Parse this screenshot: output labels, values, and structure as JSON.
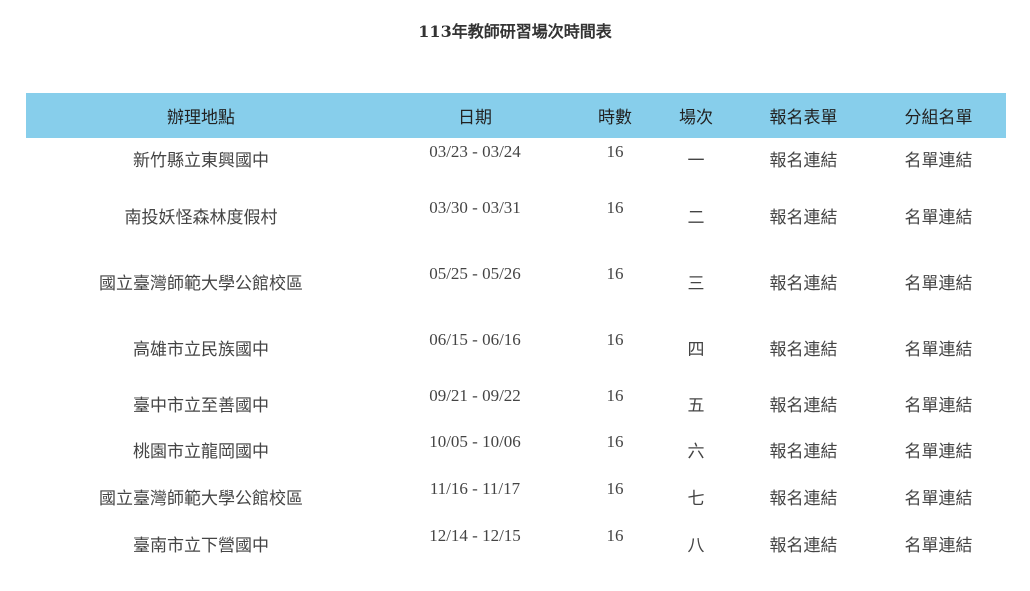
{
  "title": "113年教師研習場次時間表",
  "headers": {
    "location": "辦理地點",
    "date": "日期",
    "hours": "時數",
    "session": "場次",
    "form": "報名表單",
    "group": "分組名單"
  },
  "rows": [
    {
      "location": "新竹縣立東興國中",
      "date": "03/23 - 03/24",
      "hours": "16",
      "session": "一",
      "form": "報名連結",
      "group": "名單連結"
    },
    {
      "location": "南投妖怪森林度假村",
      "date": "03/30 - 03/31",
      "hours": "16",
      "session": "二",
      "form": "報名連結",
      "group": "名單連結"
    },
    {
      "location": "國立臺灣師範大學公館校區",
      "date": "05/25 - 05/26",
      "hours": "16",
      "session": "三",
      "form": "報名連結",
      "group": "名單連結"
    },
    {
      "location": "高雄市立民族國中",
      "date": "06/15 - 06/16",
      "hours": "16",
      "session": "四",
      "form": "報名連結",
      "group": "名單連結"
    },
    {
      "location": "臺中市立至善國中",
      "date": "09/21 - 09/22",
      "hours": "16",
      "session": "五",
      "form": "報名連結",
      "group": "名單連結"
    },
    {
      "location": "桃園市立龍岡國中",
      "date": "10/05 - 10/06",
      "hours": "16",
      "session": "六",
      "form": "報名連結",
      "group": "名單連結"
    },
    {
      "location": "國立臺灣師範大學公館校區",
      "date": "11/16 - 11/17",
      "hours": "16",
      "session": "七",
      "form": "報名連結",
      "group": "名單連結"
    },
    {
      "location": "臺南市立下營國中",
      "date": "12/14 - 12/15",
      "hours": "16",
      "session": "八",
      "form": "報名連結",
      "group": "名單連結"
    }
  ]
}
